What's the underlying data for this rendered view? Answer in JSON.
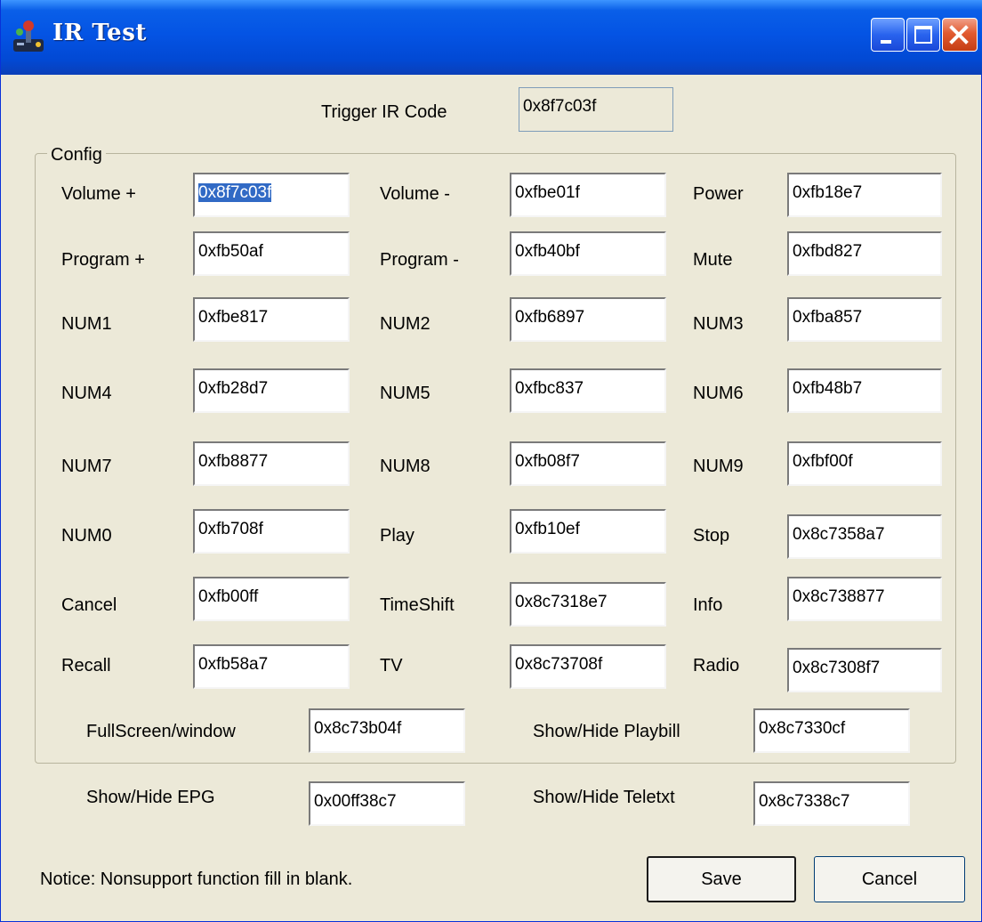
{
  "window": {
    "title": "IR Test",
    "app_icon": "joystick-icon"
  },
  "title_buttons": {
    "minimize": "minimize-icon",
    "maximize": "maximize-icon",
    "close": "close-icon"
  },
  "trigger": {
    "label": "Trigger IR Code",
    "value": "0x8f7c03f"
  },
  "config": {
    "legend": "Config",
    "volume_plus": {
      "label": "Volume +",
      "value": "0x8f7c03f"
    },
    "volume_minus": {
      "label": "Volume -",
      "value": "0xfbe01f"
    },
    "power": {
      "label": "Power",
      "value": "0xfb18e7"
    },
    "program_plus": {
      "label": "Program +",
      "value": "0xfb50af"
    },
    "program_minus": {
      "label": "Program -",
      "value": "0xfb40bf"
    },
    "mute": {
      "label": "Mute",
      "value": "0xfbd827"
    },
    "num1": {
      "label": "NUM1",
      "value": "0xfbe817"
    },
    "num2": {
      "label": "NUM2",
      "value": "0xfb6897"
    },
    "num3": {
      "label": "NUM3",
      "value": "0xfba857"
    },
    "num4": {
      "label": "NUM4",
      "value": "0xfb28d7"
    },
    "num5": {
      "label": "NUM5",
      "value": "0xfbc837"
    },
    "num6": {
      "label": "NUM6",
      "value": "0xfb48b7"
    },
    "num7": {
      "label": "NUM7",
      "value": "0xfb8877"
    },
    "num8": {
      "label": "NUM8",
      "value": "0xfb08f7"
    },
    "num9": {
      "label": "NUM9",
      "value": "0xfbf00f"
    },
    "num0": {
      "label": "NUM0",
      "value": "0xfb708f"
    },
    "play": {
      "label": "Play",
      "value": "0xfb10ef"
    },
    "stop": {
      "label": "Stop",
      "value": "0x8c7358a7"
    },
    "cancel": {
      "label": "Cancel",
      "value": "0xfb00ff"
    },
    "timeshift": {
      "label": "TimeShift",
      "value": "0x8c7318e7"
    },
    "info": {
      "label": "Info",
      "value": "0x8c738877"
    },
    "recall": {
      "label": "Recall",
      "value": "0xfb58a7"
    },
    "tv": {
      "label": "TV",
      "value": "0x8c73708f"
    },
    "radio": {
      "label": "Radio",
      "value": "0x8c7308f7"
    },
    "fullscreen": {
      "label": "FullScreen/window",
      "value": "0x8c73b04f"
    },
    "playbill": {
      "label": "Show/Hide Playbill",
      "value": "0x8c7330cf"
    },
    "epg": {
      "label": "Show/Hide EPG",
      "value": "0x00ff38c7"
    },
    "teletext": {
      "label": "Show/Hide Teletxt",
      "value": "0x8c7338c7"
    }
  },
  "footer": {
    "notice": "Notice: Nonsupport function fill in blank.",
    "save_label": "Save",
    "cancel_label": "Cancel"
  }
}
